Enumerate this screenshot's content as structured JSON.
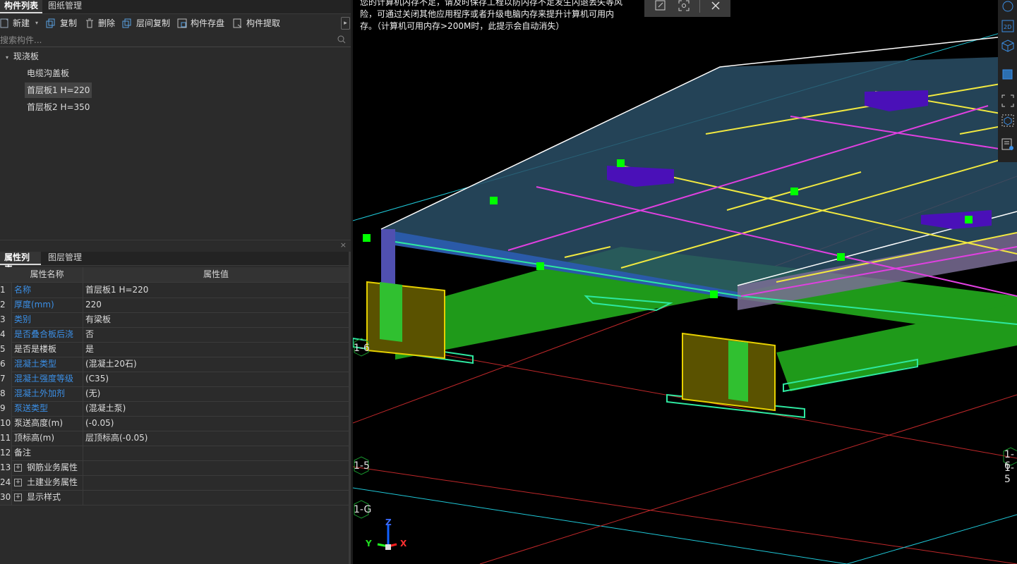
{
  "top_tabs": [
    "构件列表",
    "图纸管理"
  ],
  "toolbar": {
    "new": "新建",
    "copy": "复制",
    "delete": "删除",
    "floor_copy": "层间复制",
    "save_component": "构件存盘",
    "extract_component": "构件提取"
  },
  "search": {
    "placeholder": "搜索构件..."
  },
  "tree": {
    "group": "现浇板",
    "items": [
      "电缆沟盖板",
      "首层板1 H=220",
      "首层板2 H=350"
    ],
    "selected_index": 1
  },
  "bottom_tabs": [
    "属性列表",
    "图层管理"
  ],
  "grid": {
    "headers": [
      "属性名称",
      "属性值"
    ],
    "rows": [
      {
        "num": "1",
        "name": "名称",
        "value": "首层板1 H=220",
        "blue": true
      },
      {
        "num": "2",
        "name": "厚度(mm)",
        "value": "220",
        "blue": true
      },
      {
        "num": "3",
        "name": "类别",
        "value": "有梁板",
        "blue": true
      },
      {
        "num": "4",
        "name": "是否叠合板后浇",
        "value": "否",
        "blue": true
      },
      {
        "num": "5",
        "name": "是否是楼板",
        "value": "是",
        "blue": false
      },
      {
        "num": "6",
        "name": "混凝土类型",
        "value": "(混凝土20石)",
        "blue": true
      },
      {
        "num": "7",
        "name": "混凝土强度等级",
        "value": "(C35)",
        "blue": true
      },
      {
        "num": "8",
        "name": "混凝土外加剂",
        "value": "(无)",
        "blue": true
      },
      {
        "num": "9",
        "name": "泵送类型",
        "value": "(混凝土泵)",
        "blue": true
      },
      {
        "num": "10",
        "name": "泵送高度(m)",
        "value": "(-0.05)",
        "blue": false
      },
      {
        "num": "11",
        "name": "顶标高(m)",
        "value": "层顶标高(-0.05)",
        "blue": false
      },
      {
        "num": "12",
        "name": "备注",
        "value": "",
        "blue": false
      },
      {
        "num": "13",
        "name": "钢筋业务属性",
        "value": "",
        "blue": false,
        "expand": true
      },
      {
        "num": "24",
        "name": "土建业务属性",
        "value": "",
        "blue": false,
        "expand": true
      },
      {
        "num": "30",
        "name": "显示样式",
        "value": "",
        "blue": false,
        "expand": true
      }
    ]
  },
  "viewport": {
    "message": "您的计算机内存不足，请及时保存工程以防内存不足发生闪退丢失等风险，可通过关闭其他应用程序或者升级电脑内存来提升计算机可用内存。（计算机可用内存>200M时，此提示会自动消失）",
    "axis_labels": [
      "1-6",
      "1-5",
      "1-G",
      "1-6",
      "1-5"
    ],
    "gizmo": {
      "z": "Z",
      "y": "Y",
      "x": "X"
    }
  },
  "colors": {
    "accent_blue": "#3b8fe6",
    "slab_grid_yellow": "#f2e940",
    "slab_grid_magenta": "#e040e0"
  }
}
